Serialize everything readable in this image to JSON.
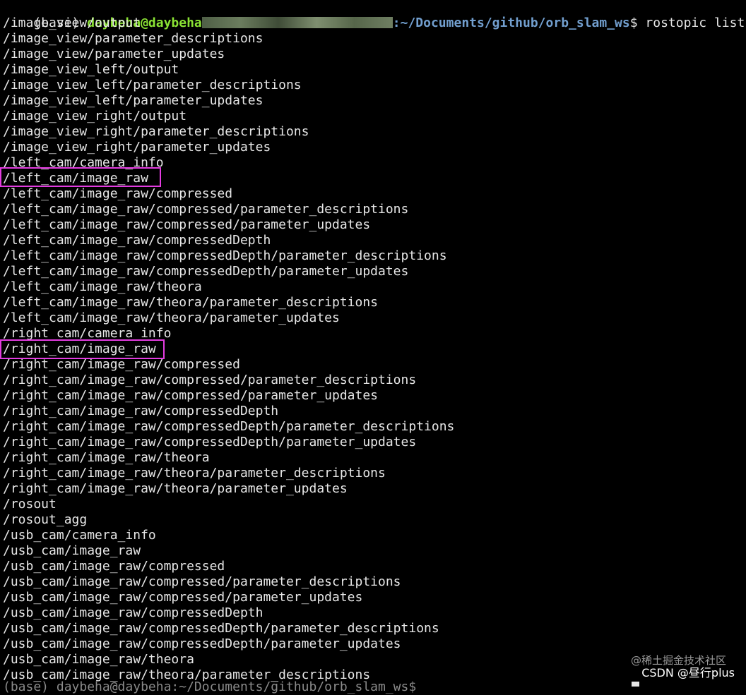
{
  "terminal": {
    "prompt": {
      "env": "(base) ",
      "user": "daybeha@daybeha",
      "path": ":~/Documents/github/orb_slam_ws",
      "symbol": "$",
      "command": " rostopic list"
    },
    "lines": [
      "/image_view/output",
      "/image_view/parameter_descriptions",
      "/image_view/parameter_updates",
      "/image_view_left/output",
      "/image_view_left/parameter_descriptions",
      "/image_view_left/parameter_updates",
      "/image_view_right/output",
      "/image_view_right/parameter_descriptions",
      "/image_view_right/parameter_updates",
      "/left_cam/camera_info",
      "/left_cam/image_raw",
      "/left_cam/image_raw/compressed",
      "/left_cam/image_raw/compressed/parameter_descriptions",
      "/left_cam/image_raw/compressed/parameter_updates",
      "/left_cam/image_raw/compressedDepth",
      "/left_cam/image_raw/compressedDepth/parameter_descriptions",
      "/left_cam/image_raw/compressedDepth/parameter_updates",
      "/left_cam/image_raw/theora",
      "/left_cam/image_raw/theora/parameter_descriptions",
      "/left_cam/image_raw/theora/parameter_updates",
      "/right_cam/camera_info",
      "/right_cam/image_raw",
      "/right_cam/image_raw/compressed",
      "/right_cam/image_raw/compressed/parameter_descriptions",
      "/right_cam/image_raw/compressed/parameter_updates",
      "/right_cam/image_raw/compressedDepth",
      "/right_cam/image_raw/compressedDepth/parameter_descriptions",
      "/right_cam/image_raw/compressedDepth/parameter_updates",
      "/right_cam/image_raw/theora",
      "/right_cam/image_raw/theora/parameter_descriptions",
      "/right_cam/image_raw/theora/parameter_updates",
      "/rosout",
      "/rosout_agg",
      "/usb_cam/camera_info",
      "/usb_cam/image_raw",
      "/usb_cam/image_raw/compressed",
      "/usb_cam/image_raw/compressed/parameter_descriptions",
      "/usb_cam/image_raw/compressed/parameter_updates",
      "/usb_cam/image_raw/compressedDepth",
      "/usb_cam/image_raw/compressedDepth/parameter_descriptions",
      "/usb_cam/image_raw/compressedDepth/parameter_updates",
      "/usb_cam/image_raw/theora",
      "/usb_cam/image_raw/theora/parameter_descriptions"
    ],
    "partial_last_line": "(base) daybeha@daybeha:~/Documents/github/orb_slam_ws$ "
  },
  "highlights": {
    "color": "#e33ce0",
    "items": [
      "/left_cam/image_raw",
      "/right_cam/image_raw"
    ]
  },
  "watermark": {
    "line1": "@稀土掘金技术社区",
    "line2": "CSDN @昼行plus"
  },
  "colors": {
    "background": "#000000",
    "text": "#e6e6e6",
    "user": "#8ae234",
    "path": "#729fcf"
  }
}
